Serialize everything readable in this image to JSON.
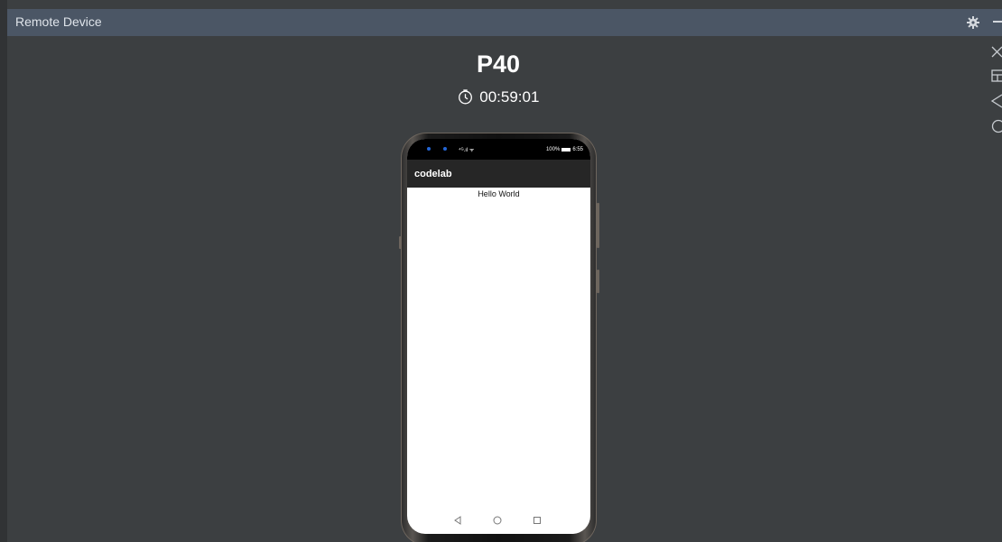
{
  "window": {
    "title": "Remote Device"
  },
  "device": {
    "name": "P40",
    "timer": "00:59:01"
  },
  "phone": {
    "status": {
      "signal": "⁴ᴳ.ıl ᯤ",
      "battery": "100%",
      "time": "6:55"
    },
    "app_title": "codelab",
    "content_text": "Hello World"
  },
  "icons": {
    "title_actions": [
      "gear-icon",
      "minimize-icon"
    ],
    "side_controls": [
      "close-icon",
      "layout-icon",
      "back-icon",
      "home-icon"
    ],
    "nav_buttons": [
      "nav-back-icon",
      "nav-home-icon",
      "nav-recents-icon"
    ]
  },
  "colors": {
    "background": "#3c3f41",
    "titlebar": "#4b5665",
    "phone_appbar": "#262626",
    "status_dot": "#2466d6"
  }
}
